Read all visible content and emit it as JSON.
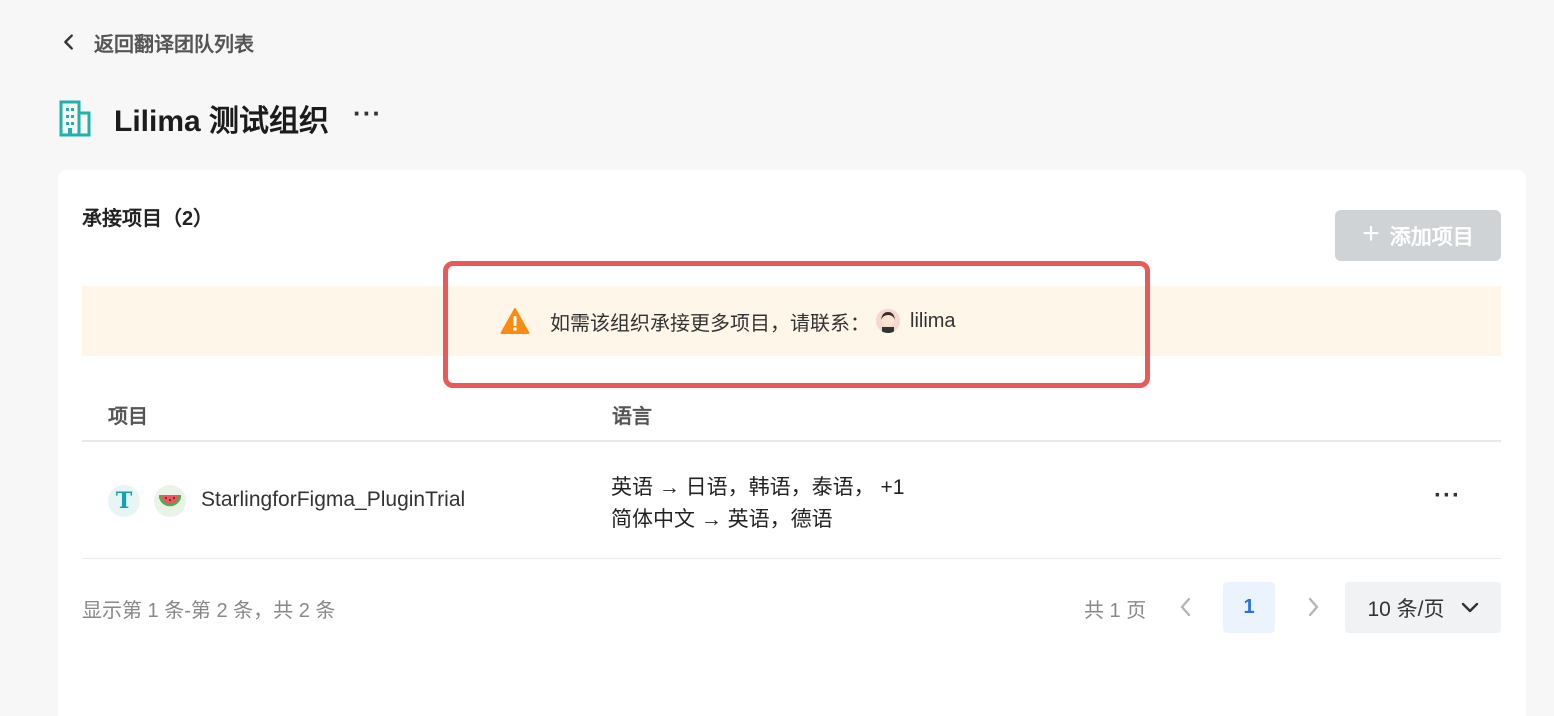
{
  "nav": {
    "back_label": "返回翻译团队列表"
  },
  "header": {
    "org_name": "Lilima 测试组织",
    "more_label": "···"
  },
  "section": {
    "title": "承接项目（2）",
    "add_button_label": "添加项目"
  },
  "notice": {
    "text": "如需该组织承接更多项目，请联系：",
    "contact": "lilima"
  },
  "table": {
    "columns": [
      "项目",
      "语言"
    ],
    "rows": [
      {
        "project": "StarlingforFigma_PluginTrial",
        "languages": [
          "英语 → 日语，韩语，泰语， +1",
          "简体中文 → 英语，德语"
        ],
        "more_label": "···"
      }
    ]
  },
  "footer": {
    "range_text": "显示第 1 条-第 2 条，共 2 条",
    "total_pages_text": "共 1 页",
    "current_page": "1",
    "page_size_label": "10 条/页"
  },
  "colors": {
    "accent": "#2673dd",
    "warning": "#fa8c16",
    "highlight_border": "#e8595a",
    "org_icon": "#20b2aa"
  }
}
